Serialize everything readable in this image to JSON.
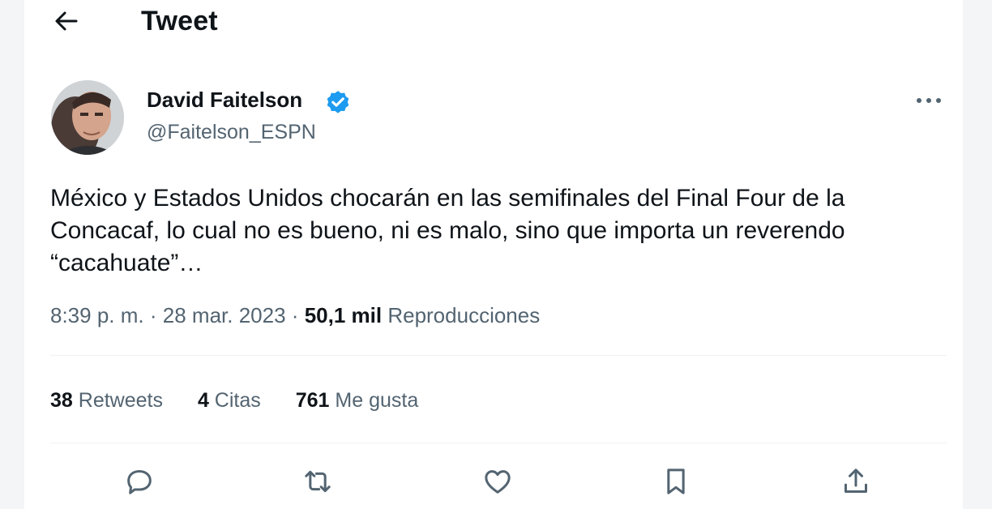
{
  "header": {
    "title": "Tweet",
    "back_icon": "arrow-left-icon"
  },
  "tweet": {
    "author": {
      "name": "David Faitelson",
      "handle": "@Faitelson_ESPN",
      "verified_color": "#1d9bf0"
    },
    "text": "México y Estados Unidos chocarán en las semifinales del Final Four de la Concacaf, lo cual no es bueno, ni es malo, sino que importa un reverendo “cacahuate”…",
    "time": "8:39 p. m.",
    "separator": "·",
    "date": "28 mar. 2023",
    "views_count": "50,1 mil",
    "views_label": "Reproducciones",
    "stats": [
      {
        "count": "38",
        "label": "Retweets"
      },
      {
        "count": "4",
        "label": "Citas"
      },
      {
        "count": "761",
        "label": "Me gusta"
      }
    ],
    "actions": [
      "reply-icon",
      "retweet-icon",
      "like-icon",
      "bookmark-icon",
      "share-icon"
    ]
  },
  "colors": {
    "text_primary": "#0f1419",
    "text_secondary": "#536471",
    "accent": "#1d9bf0",
    "divider": "#eff3f4"
  }
}
